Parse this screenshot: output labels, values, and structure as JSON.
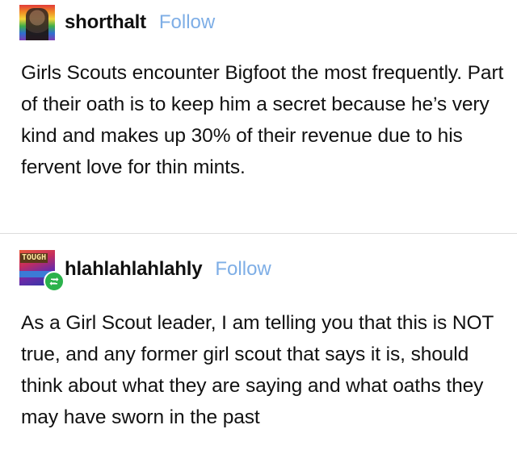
{
  "posts": [
    {
      "username": "shorthalt",
      "follow_label": "Follow",
      "avatar_icon": "profile-photo-rainbow-icon",
      "text": "Girls Scouts encounter Bigfoot the most frequently. Part of their oath is to keep him a secret because he’s very kind and makes up 30% of their revenue due to his fervent love for thin mints."
    },
    {
      "username": "hlahlahlahlahly",
      "follow_label": "Follow",
      "avatar_icon": "profile-photo-tough-icon",
      "avatar_text": "TOUGH",
      "badge_icon": "reblog-icon",
      "text": "As a Girl Scout leader, I am telling you that this is NOT true, and any former girl scout that says it is, should think about what they are saying and what oaths they may have sworn in the past"
    }
  ],
  "colors": {
    "follow": "#7eaee6",
    "text": "#111111",
    "divider": "#dcdcdc",
    "reblog_badge": "#2bb24c"
  }
}
